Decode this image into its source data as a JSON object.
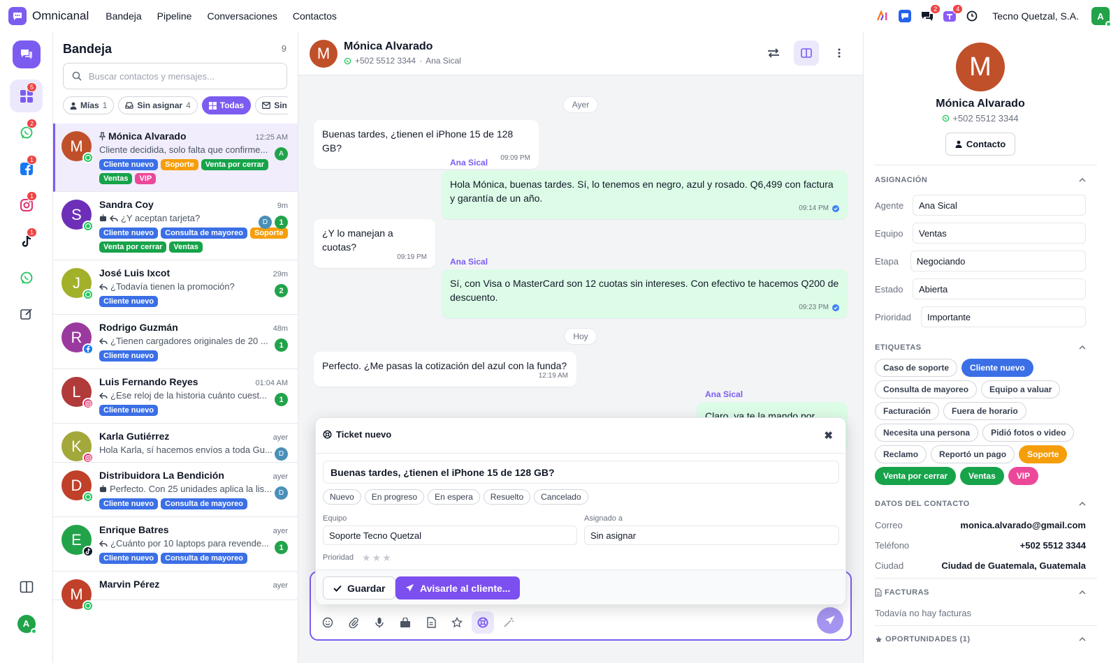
{
  "app": {
    "name": "Omnicanal",
    "nav": [
      "Bandeja",
      "Pipeline",
      "Conversaciones",
      "Contactos"
    ],
    "company": "Tecno Quetzal, S.A.",
    "user_initial": "A",
    "topbar_badges": {
      "chat": "2",
      "teams": "4"
    }
  },
  "rail": {
    "badges": {
      "inbox": "5",
      "whatsapp": "2",
      "facebook": "1",
      "instagram": "1",
      "tiktok": "1"
    },
    "user_initial": "A"
  },
  "inbox": {
    "title": "Bandeja",
    "count": "9",
    "search_placeholder": "Buscar contactos y mensajes...",
    "filters": [
      {
        "label": "Mías",
        "count": "1"
      },
      {
        "label": "Sin asignar",
        "count": "4"
      },
      {
        "label": "Todas",
        "count": ""
      },
      {
        "label": "Sin",
        "count": ""
      }
    ],
    "conversations": [
      {
        "initial": "M",
        "name": "Mónica Alvarado",
        "time": "12:25 AM",
        "preview": "Cliente decidida, solo falta que confirme...",
        "channel": "whatsapp",
        "avatar_color": "#c0502a",
        "agent": "A",
        "agent_color": "#22a34a",
        "unread": "",
        "pinned": true,
        "tags": [
          "Cliente nuevo",
          "Soporte",
          "Venta por cerrar",
          "Ventas",
          "VIP"
        ]
      },
      {
        "initial": "S",
        "name": "Sandra Coy",
        "time": "9m",
        "preview": "¿Y aceptan tarjeta?",
        "channel": "whatsapp",
        "avatar_color": "#6d2fb8",
        "agent": "D",
        "agent_color": "#4a90b8",
        "unread": "1",
        "tags": [
          "Cliente nuevo",
          "Consulta de mayoreo",
          "Soporte",
          "Venta por cerrar",
          "Ventas"
        ]
      },
      {
        "initial": "J",
        "name": "José Luis Ixcot",
        "time": "29m",
        "preview": "¿Todavía tienen la promoción?",
        "channel": "whatsapp",
        "avatar_color": "#a3b02a",
        "agent": "",
        "unread": "2",
        "tags": [
          "Cliente nuevo"
        ]
      },
      {
        "initial": "R",
        "name": "Rodrigo Guzmán",
        "time": "48m",
        "preview": "¿Tienen cargadores originales de 20 ...",
        "channel": "facebook",
        "avatar_color": "#9b3a9e",
        "agent": "",
        "unread": "1",
        "tags": [
          "Cliente nuevo"
        ]
      },
      {
        "initial": "L",
        "name": "Luis Fernando Reyes",
        "time": "01:04 AM",
        "preview": "¿Ese reloj de la historia cuánto cuest...",
        "channel": "instagram",
        "avatar_color": "#b13a3a",
        "agent": "",
        "unread": "1",
        "tags": [
          "Cliente nuevo"
        ]
      },
      {
        "initial": "K",
        "name": "Karla Gutiérrez",
        "time": "ayer",
        "preview": "Hola Karla, sí hacemos envíos a toda Gu...",
        "channel": "instagram",
        "avatar_color": "#a3a83a",
        "agent": "D",
        "agent_color": "#4a90b8",
        "unread": "",
        "tags": []
      },
      {
        "initial": "D",
        "name": "Distribuidora La Bendición",
        "time": "ayer",
        "preview": "Perfecto. Con 25 unidades aplica la lis...",
        "channel": "whatsapp",
        "avatar_color": "#c0402a",
        "agent": "D",
        "agent_color": "#4a90b8",
        "unread": "",
        "tags": [
          "Cliente nuevo",
          "Consulta de mayoreo"
        ]
      },
      {
        "initial": "E",
        "name": "Enrique Batres",
        "time": "ayer",
        "preview": "¿Cuánto por 10 laptops para revende...",
        "channel": "tiktok",
        "avatar_color": "#22a34a",
        "agent": "",
        "unread": "1",
        "tags": [
          "Cliente nuevo",
          "Consulta de mayoreo"
        ]
      },
      {
        "initial": "M",
        "name": "Marvin Pérez",
        "time": "ayer",
        "preview": "",
        "channel": "whatsapp",
        "avatar_color": "#c0402a",
        "agent": "",
        "unread": "",
        "tags": []
      }
    ]
  },
  "tag_colors": {
    "Cliente nuevo": "#3b6fe6",
    "Soporte": "#f59e0b",
    "Venta por cerrar": "#16a34a",
    "Ventas": "#16a34a",
    "VIP": "#ec4899",
    "Consulta de mayoreo": "#3b6fe6"
  },
  "chat": {
    "name": "Mónica Alvarado",
    "phone": "+502 5512 3344",
    "agent": "Ana Sical",
    "day_ayer": "Ayer",
    "day_hoy": "Hoy",
    "messages": [
      {
        "text": "Buenas tardes, ¿tienen el iPhone 15 de 128 GB?",
        "time": "09:09 PM"
      },
      {
        "sender": "Ana Sical",
        "text": "Hola Mónica, buenas tardes. Sí, lo tenemos en negro, azul y rosado. Q6,499 con factura y garantía de un año.",
        "time": "09:14 PM"
      },
      {
        "text": "¿Y lo manejan a cuotas?",
        "time": "09:19 PM"
      },
      {
        "sender": "Ana Sical",
        "text": "Sí, con Visa o MasterCard son 12 cuotas sin intereses. Con efectivo te hacemos Q200 de descuento.",
        "time": "09:23 PM"
      },
      {
        "text": "Perfecto. ¿Me pasas la cotización del azul con la funda?",
        "time": "12:19 AM"
      },
      {
        "sender": "Ana Sical",
        "text": "Claro, ya te la mando por aquí.",
        "time": ""
      }
    ]
  },
  "ticket": {
    "title": "Ticket nuevo",
    "subject": "Buenas tardes, ¿tienen el iPhone 15 de 128 GB?",
    "statuses": [
      "Nuevo",
      "En progreso",
      "En espera",
      "Resuelto",
      "Cancelado"
    ],
    "team_label": "Equipo",
    "team_value": "Soporte Tecno Quetzal",
    "assignee_label": "Asignado a",
    "assignee_value": "Sin asignar",
    "priority_label": "Prioridad",
    "priority_stars": 0,
    "save_label": "Guardar",
    "notify_label": "Avisarle al cliente..."
  },
  "contact": {
    "initial": "M",
    "name": "Mónica Alvarado",
    "phone": "+502 5512 3344",
    "button": "Contacto",
    "assignment_title": "ASIGNACIÓN",
    "fields": [
      {
        "label": "Agente",
        "value": "Ana Sical"
      },
      {
        "label": "Equipo",
        "value": "Ventas"
      },
      {
        "label": "Etapa",
        "value": "Negociando"
      },
      {
        "label": "Estado",
        "value": "Abierta"
      },
      {
        "label": "Prioridad",
        "value": "Importante"
      }
    ],
    "tags_title": "ETIQUETAS",
    "tags": [
      {
        "label": "Caso de soporte",
        "active": false
      },
      {
        "label": "Cliente nuevo",
        "active": true,
        "color": "#3b6fe6"
      },
      {
        "label": "Consulta de mayoreo",
        "active": false
      },
      {
        "label": "Equipo a valuar",
        "active": false
      },
      {
        "label": "Facturación",
        "active": false
      },
      {
        "label": "Fuera de horario",
        "active": false
      },
      {
        "label": "Necesita una persona",
        "active": false
      },
      {
        "label": "Pidió fotos o video",
        "active": false
      },
      {
        "label": "Reclamo",
        "active": false
      },
      {
        "label": "Reportó un pago",
        "active": false
      },
      {
        "label": "Soporte",
        "active": true,
        "color": "#f59e0b"
      },
      {
        "label": "Venta por cerrar",
        "active": true,
        "color": "#16a34a"
      },
      {
        "label": "Ventas",
        "active": true,
        "color": "#16a34a"
      },
      {
        "label": "VIP",
        "active": true,
        "color": "#ec4899"
      }
    ],
    "data_title": "DATOS DEL CONTACTO",
    "data": [
      {
        "label": "Correo",
        "value": "monica.alvarado@gmail.com"
      },
      {
        "label": "Teléfono",
        "value": "+502 5512 3344"
      },
      {
        "label": "Ciudad",
        "value": "Ciudad de Guatemala, Guatemala"
      }
    ],
    "invoices_title": "FACTURAS",
    "invoices_empty": "Todavía no hay facturas",
    "opportunities_title": "OPORTUNIDADES (1)"
  }
}
